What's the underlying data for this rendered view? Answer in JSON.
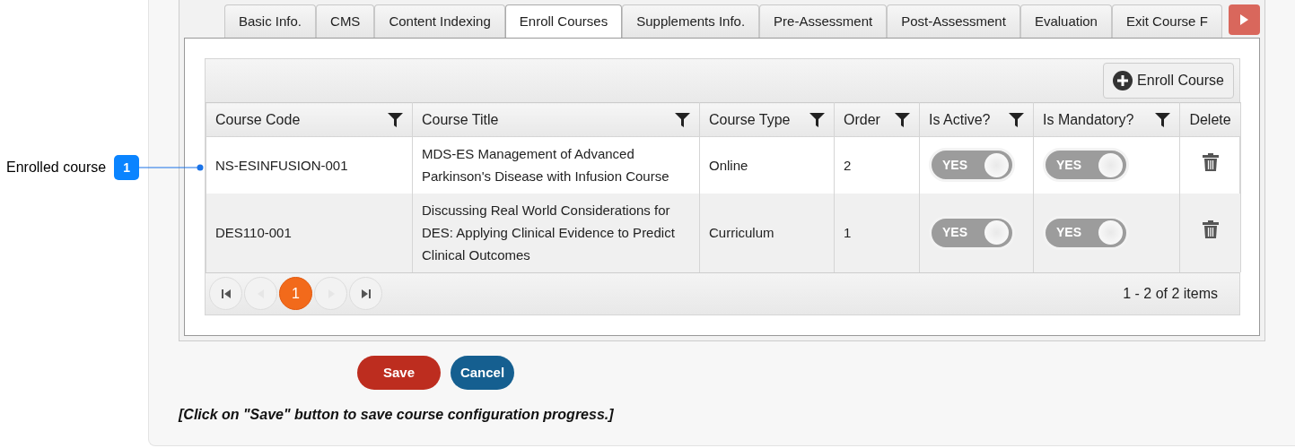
{
  "tabs": [
    {
      "label": "Basic Info.",
      "selected": false
    },
    {
      "label": "CMS",
      "selected": false
    },
    {
      "label": "Content Indexing",
      "selected": false
    },
    {
      "label": "Enroll Courses",
      "selected": true
    },
    {
      "label": "Supplements Info.",
      "selected": false
    },
    {
      "label": "Pre-Assessment",
      "selected": false
    },
    {
      "label": "Post-Assessment",
      "selected": false
    },
    {
      "label": "Evaluation",
      "selected": false
    },
    {
      "label": "Exit Course F",
      "selected": false
    }
  ],
  "toolbar": {
    "enroll_button": "Enroll Course"
  },
  "table": {
    "columns": [
      {
        "label": "Course Code",
        "filter": true
      },
      {
        "label": "Course Title",
        "filter": true
      },
      {
        "label": "Course Type",
        "filter": true
      },
      {
        "label": "Order",
        "filter": true
      },
      {
        "label": "Is Active?",
        "filter": true
      },
      {
        "label": "Is Mandatory?",
        "filter": true
      },
      {
        "label": "Delete",
        "filter": false
      }
    ],
    "rows": [
      {
        "code": "NS-ESINFUSION-001",
        "title": "MDS-ES Management of Advanced Parkinson's Disease with Infusion Course",
        "type": "Online",
        "order": "2",
        "is_active": {
          "label": "YES",
          "on": true
        },
        "is_mandatory": {
          "label": "YES",
          "on": true
        }
      },
      {
        "code": "DES110-001",
        "title": "Discussing Real World Considerations for DES: Applying Clinical Evidence to Predict Clinical Outcomes",
        "type": "Curriculum",
        "order": "1",
        "is_active": {
          "label": "YES",
          "on": true
        },
        "is_mandatory": {
          "label": "YES",
          "on": true
        }
      }
    ]
  },
  "pager": {
    "nav_buttons": [
      {
        "kind": "first",
        "disabled": false
      },
      {
        "kind": "prev",
        "disabled": true
      },
      {
        "kind": "next",
        "disabled": true
      },
      {
        "kind": "last",
        "disabled": false
      }
    ],
    "pages": [
      {
        "label": "1",
        "selected": true
      }
    ],
    "summary": "1 - 2 of 2 items"
  },
  "callout": {
    "label": "Enrolled course",
    "number": "1"
  },
  "buttons": [
    {
      "kind": "save",
      "label": "Save"
    },
    {
      "kind": "cancel",
      "label": "Cancel"
    }
  ],
  "note": "[Click on \"Save\" button to save course configuration progress.]"
}
